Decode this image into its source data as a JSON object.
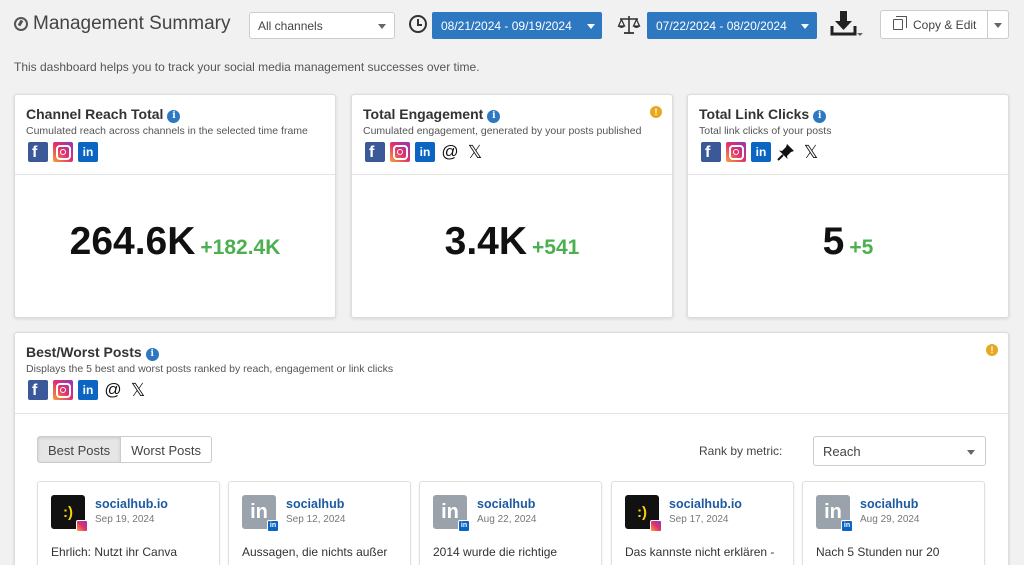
{
  "header": {
    "title": "Management Summary",
    "channel_select": {
      "value": "All channels"
    },
    "date_range_primary": "08/21/2024 - 09/19/2024",
    "date_range_compare": "07/22/2024 - 08/20/2024",
    "copy_edit_label": "Copy & Edit"
  },
  "subtitle": "This dashboard helps you to track your social media management successes over time.",
  "icons": {
    "facebook": "f",
    "linkedin": "in",
    "threads": "@",
    "x": "𝕏",
    "info": "i",
    "warning": "!",
    "socialhub_avatar": ":)",
    "linkedin_avatar": "in"
  },
  "cards": [
    {
      "title": "Channel Reach Total",
      "description": "Cumulated reach across channels in the selected time frame",
      "value": "264.6K",
      "delta": "+182.4K"
    },
    {
      "title": "Total Engagement",
      "description": "Cumulated engagement, generated by your posts published",
      "value": "3.4K",
      "delta": "+541"
    },
    {
      "title": "Total Link Clicks",
      "description": "Total link clicks of your posts",
      "value": "5",
      "delta": "+5"
    }
  ],
  "best_worst": {
    "title": "Best/Worst Posts",
    "description": "Displays the 5 best and worst posts ranked by reach, engagement or link clicks",
    "tabs": [
      "Best Posts",
      "Worst Posts"
    ],
    "rank_label": "Rank by metric:",
    "rank_value": "Reach",
    "posts": [
      {
        "account": "socialhub.io",
        "date": "Sep 19, 2024",
        "text": "Ehrlich: Nutzt ihr Canva",
        "network": "instagram"
      },
      {
        "account": "socialhub",
        "date": "Sep 12, 2024",
        "text": "Aussagen, die nichts außer",
        "network": "linkedin"
      },
      {
        "account": "socialhub",
        "date": "Aug 22, 2024",
        "text": "2014 wurde die richtige",
        "network": "linkedin"
      },
      {
        "account": "socialhub.io",
        "date": "Sep 17, 2024",
        "text": "Das kannste nicht erklären -",
        "network": "instagram"
      },
      {
        "account": "socialhub",
        "date": "Aug 29, 2024",
        "text": "Nach 5 Stunden nur 20",
        "network": "linkedin"
      }
    ]
  },
  "colors": {
    "accent": "#2e78c2",
    "positive_delta": "#4caf50",
    "warning": "#e8a820",
    "facebook": "#3b5998",
    "linkedin": "#0a66c2",
    "link": "#1e5aa0"
  }
}
